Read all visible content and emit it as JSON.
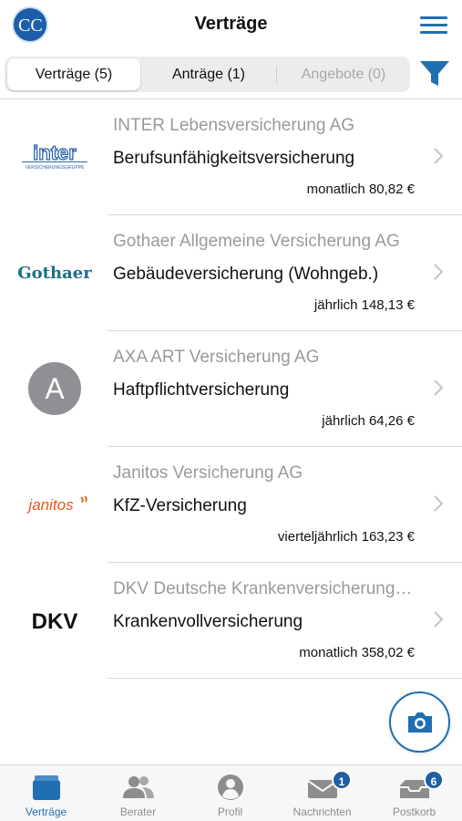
{
  "header": {
    "title": "Verträge",
    "logo_text": "CC",
    "menu_icon": "hamburger-menu-icon"
  },
  "tabs": [
    {
      "label": "Verträge (5)",
      "state": "active"
    },
    {
      "label": "Anträge (1)",
      "state": "normal"
    },
    {
      "label": "Angebote (0)",
      "state": "disabled"
    }
  ],
  "filter_icon": "filter-funnel-icon",
  "contracts": [
    {
      "company": "INTER Lebensversicherung AG",
      "product": "Berufsunfähigkeitsversicherung",
      "price": "monatlich 80,82 €",
      "logo_name": "inter",
      "logo_text": "inter",
      "logo_subtext": "VERSICHERUNGSGRUPPE"
    },
    {
      "company": "Gothaer Allgemeine Versicherung AG",
      "product": "Gebäudeversicherung (Wohngeb.)",
      "price": "jährlich 148,13 €",
      "logo_name": "gothaer",
      "logo_text": "Gothaer"
    },
    {
      "company": "AXA ART Versicherung AG",
      "product": "Haftpflichtversicherung",
      "price": "jährlich 64,26 €",
      "logo_name": "avatar",
      "logo_text": "A"
    },
    {
      "company": "Janitos Versicherung AG",
      "product": "KfZ-Versicherung",
      "price": "vierteljährlich 163,23 €",
      "logo_name": "janitos",
      "logo_text": "janitos"
    },
    {
      "company": "DKV Deutsche Krankenversicherung AG",
      "product": "Krankenvollversicherung",
      "price": "monatlich 358,02 €",
      "logo_name": "dkv",
      "logo_text": "DKV"
    }
  ],
  "camera_button_icon": "camera-icon",
  "bottom_nav": [
    {
      "label": "Verträge",
      "icon": "folder-icon",
      "active": true
    },
    {
      "label": "Berater",
      "icon": "people-icon",
      "active": false
    },
    {
      "label": "Profil",
      "icon": "person-icon",
      "active": false
    },
    {
      "label": "Nachrichten",
      "icon": "envelope-icon",
      "active": false,
      "badge": "1"
    },
    {
      "label": "Postkorb",
      "icon": "inbox-tray-icon",
      "active": false,
      "badge": "6"
    }
  ],
  "colors": {
    "accent": "#1f6fb2",
    "muted_text": "#9a9a9a",
    "gothaer": "#1d6f8a",
    "janitos": "#e05a1c",
    "dkv_green": "#1a8a3a",
    "avatar_bg": "#8f8f94"
  }
}
